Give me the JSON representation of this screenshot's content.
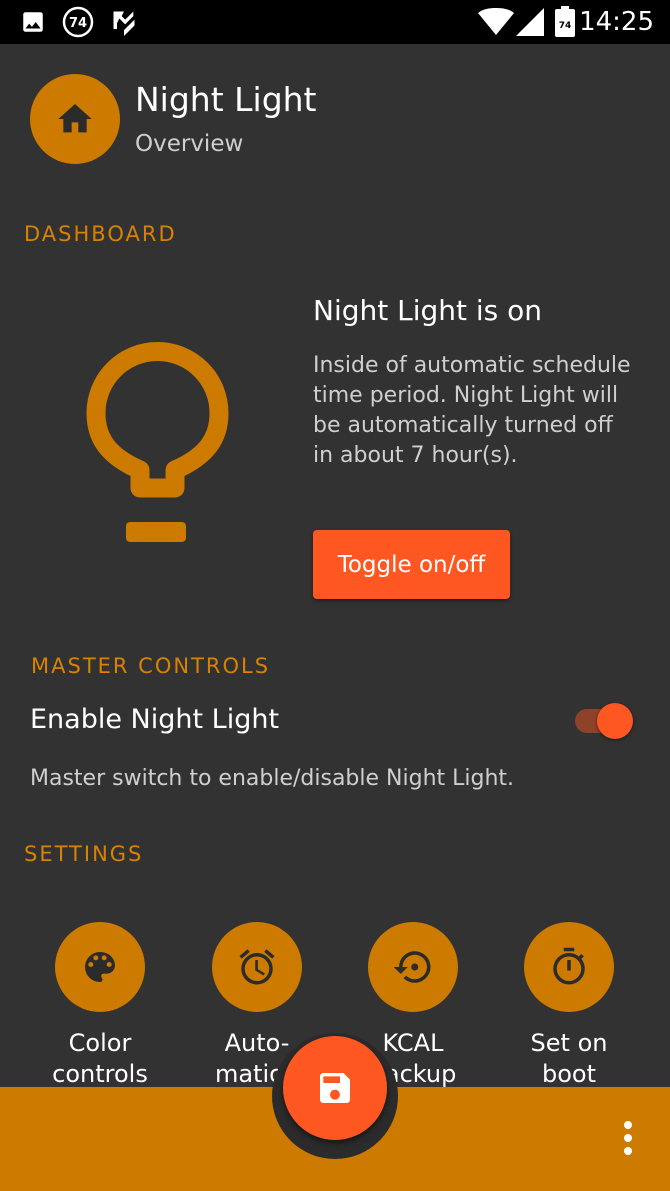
{
  "status_bar": {
    "time": "14:25",
    "notification_icons": [
      "image-icon",
      "badge-74-icon",
      "check-icon"
    ],
    "badge_number": "74",
    "battery_level_text": "74",
    "system_icons": [
      "wifi-icon",
      "signal-icon",
      "battery-icon"
    ]
  },
  "header": {
    "title": "Night Light",
    "subtitle": "Overview",
    "icon": "home-icon"
  },
  "dashboard": {
    "section_label": "DASHBOARD",
    "icon": "lightbulb-icon",
    "status_title": "Night Light is on",
    "status_description": "Inside of automatic schedule time period. Night Light will be automatically turned off in about 7 hour(s).",
    "toggle_button_label": "Toggle on/off"
  },
  "master_controls": {
    "section_label": "MASTER CONTROLS",
    "enable_title": "Enable Night Light",
    "enable_summary": "Master switch to enable/disable Night Light.",
    "enabled": true
  },
  "settings": {
    "section_label": "SETTINGS",
    "tiles": [
      {
        "line1": "Color",
        "line2": "controls",
        "icon": "palette-icon"
      },
      {
        "line1": "Auto-",
        "line2": "mation",
        "icon": "alarm-clock-icon"
      },
      {
        "line1": "KCAL",
        "line2": "backup",
        "icon": "restore-icon"
      },
      {
        "line1": "Set on",
        "line2": "boot",
        "icon": "stopwatch-icon"
      }
    ]
  },
  "bottom_bar": {
    "fab_icon": "save-icon",
    "menu_icon": "more-vert-icon"
  },
  "colors": {
    "background": "#323232",
    "accent_amber": "#cc7a00",
    "accent_orange": "#ff5722",
    "status_bar": "#000000"
  }
}
